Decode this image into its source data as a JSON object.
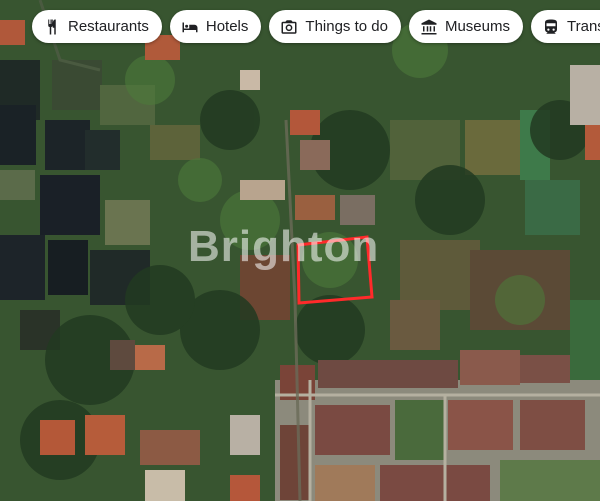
{
  "chips": [
    {
      "label": "Restaurants",
      "icon": "fork-knife-icon"
    },
    {
      "label": "Hotels",
      "icon": "bed-icon"
    },
    {
      "label": "Things to do",
      "icon": "camera-icon"
    },
    {
      "label": "Museums",
      "icon": "museum-icon"
    },
    {
      "label": "Transit",
      "icon": "train-icon"
    }
  ],
  "watermark": "Brighton",
  "highlight": {
    "color": "#ff2a2a"
  }
}
